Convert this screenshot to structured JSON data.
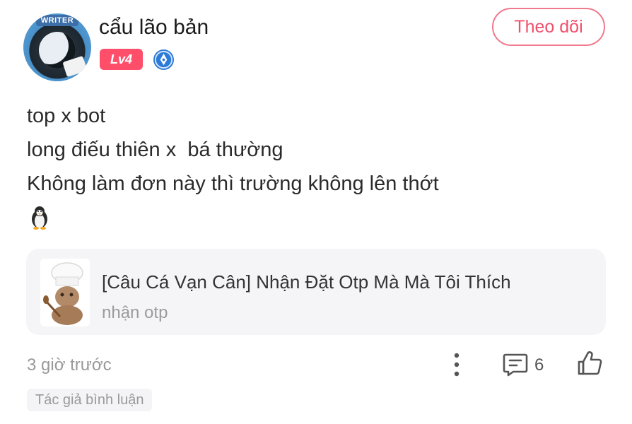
{
  "author": {
    "name": "cẩu lão bản",
    "avatar_tag": "WRITER",
    "level": "Lv4",
    "verified_icon": "pen-badge-icon"
  },
  "follow_button": {
    "label": "Theo dõi",
    "color": "#f0506c"
  },
  "post": {
    "lines": [
      "top x bot",
      "long điếu thiên x  bá thường",
      "Không làm đơn này thì trường không lên thớt"
    ],
    "emoji_icon": "penguin-icon"
  },
  "linked_card": {
    "title": "[Câu Cá Vạn Cân] Nhận Đặt Otp Mà Mà Tôi Thích",
    "subtitle": "nhận otp",
    "thumbnail_icon": "chef-cat-thumbnail"
  },
  "footer": {
    "timestamp": "3 giờ trước",
    "comment_count": "6",
    "author_tag": "Tác giả bình luận"
  },
  "colors": {
    "accent": "#ff4e6a",
    "muted_text": "#999999",
    "card_bg": "#f5f5f7"
  }
}
